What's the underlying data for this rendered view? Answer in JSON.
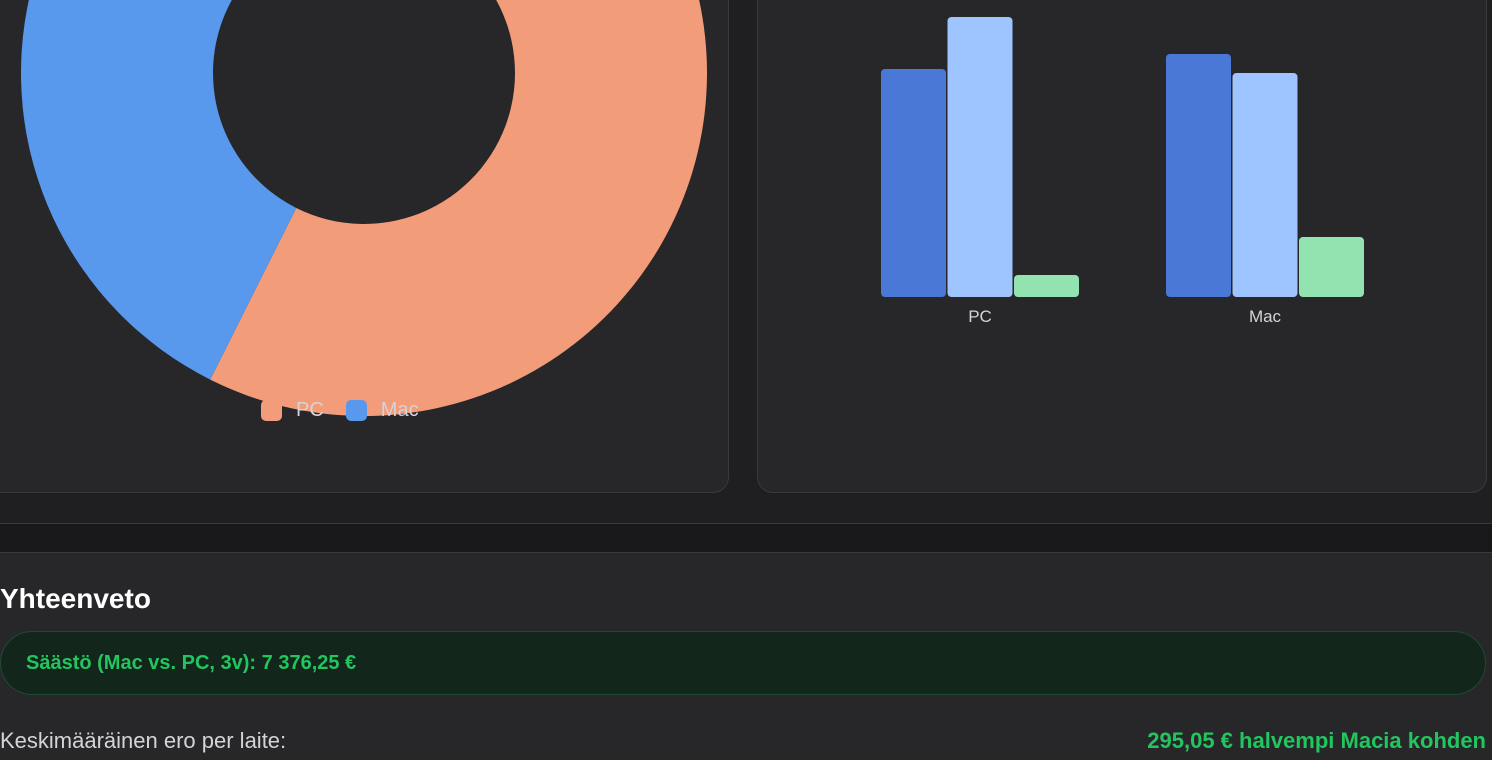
{
  "pie_legend": {
    "pc_label": "PC",
    "mac_label": "Mac"
  },
  "summary": {
    "title": "Yhteenveto",
    "savings_text": "Säästö (Mac vs. PC, 3v): 7 376,25 €",
    "diff_label": "Keskimääräinen ero per laite:",
    "diff_value": "295,05 € halvempi Macia kohden"
  },
  "colors": {
    "pc": "#f29c7a",
    "mac": "#5899ee",
    "bar_dark_blue": "#4a78d6",
    "bar_light_blue": "#9ec5ff",
    "bar_green": "#93e3b0",
    "positive": "#22c55e"
  },
  "chart_data": [
    {
      "type": "pie",
      "labels": [
        "PC",
        "Mac"
      ],
      "values": [
        57.4,
        42.6
      ],
      "donut": true
    },
    {
      "type": "bar",
      "categories": [
        "PC",
        "Mac"
      ],
      "series": [
        {
          "values": [
            228,
            243
          ]
        },
        {
          "values": [
            280,
            224
          ]
        },
        {
          "values": [
            22,
            60
          ]
        }
      ]
    }
  ]
}
